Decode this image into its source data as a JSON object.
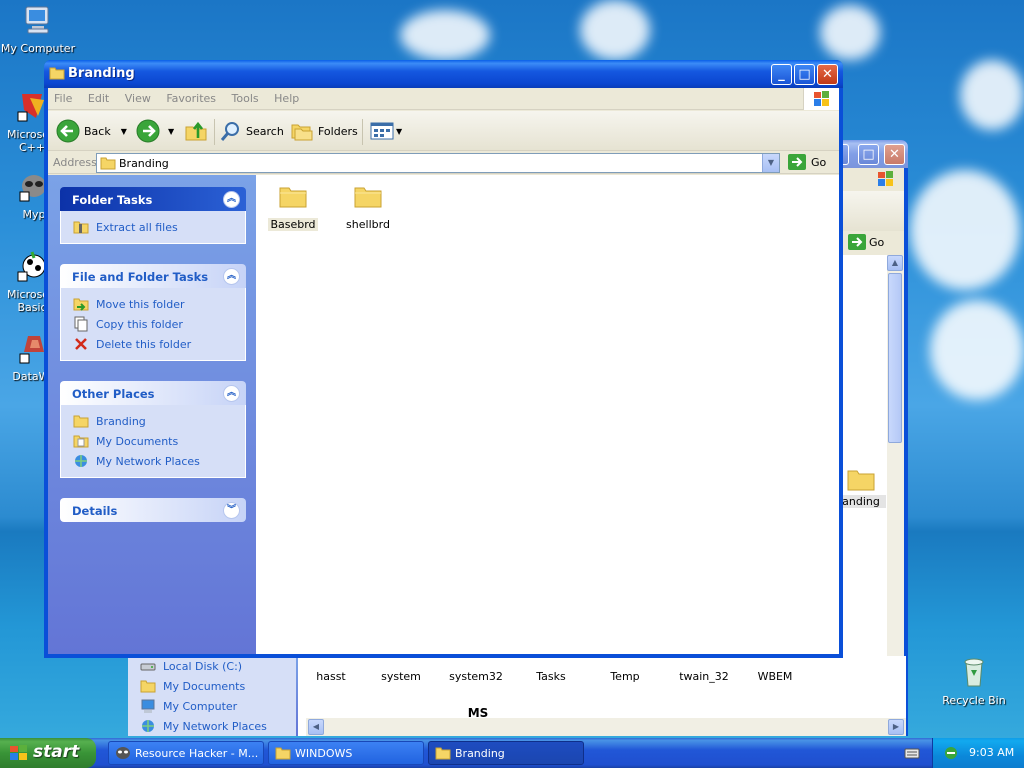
{
  "desktop": {
    "icons": [
      {
        "label": "My Computer"
      },
      {
        "label": "Microsoft C++"
      },
      {
        "label": "Myp"
      },
      {
        "label": "Microsoft Basic"
      },
      {
        "label": "DataWa"
      },
      {
        "label": "Recycle Bin"
      }
    ]
  },
  "bg_window": {
    "go_label": "Go",
    "partial_folder": "anding",
    "side_items": [
      "Local Disk (C:)",
      "My Documents",
      "My Computer",
      "My Network Places"
    ],
    "folders": [
      "hasst",
      "system",
      "system32",
      "Tasks",
      "Temp",
      "twain_32",
      "WBEM"
    ],
    "partial_label": "MS"
  },
  "window": {
    "title": "Branding",
    "menu": [
      "File",
      "Edit",
      "View",
      "Favorites",
      "Tools",
      "Help"
    ],
    "toolbar": {
      "back": "Back",
      "search": "Search",
      "folders": "Folders"
    },
    "address": {
      "label": "Address",
      "value": "Branding",
      "go": "Go"
    },
    "panels": {
      "folder_tasks": {
        "title": "Folder Tasks",
        "items": [
          "Extract all files"
        ]
      },
      "file_folder_tasks": {
        "title": "File and Folder Tasks",
        "items": [
          "Move this folder",
          "Copy this folder",
          "Delete this folder"
        ]
      },
      "other_places": {
        "title": "Other Places",
        "items": [
          "Branding",
          "My Documents",
          "My Network Places"
        ]
      },
      "details": {
        "title": "Details"
      }
    },
    "files": [
      "Basebrd",
      "shellbrd"
    ]
  },
  "taskbar": {
    "start": "start",
    "buttons": [
      "Resource Hacker - M...",
      "WINDOWS",
      "Branding"
    ],
    "clock": "9:03 AM"
  }
}
